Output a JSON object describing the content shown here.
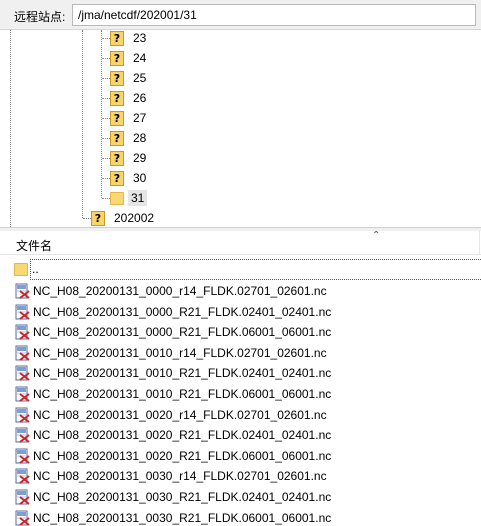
{
  "path_bar": {
    "label": "远程站点:",
    "value": "/jma/netcdf/202001/31"
  },
  "tree": {
    "day_items": [
      "23",
      "24",
      "25",
      "26",
      "27",
      "28",
      "29",
      "30"
    ],
    "selected_item": "31",
    "next_month": "202002"
  },
  "file_list": {
    "column_header": "文件名",
    "parent_entry": "..",
    "files": [
      "NC_H08_20200131_0000_r14_FLDK.02701_02601.nc",
      "NC_H08_20200131_0000_R21_FLDK.02401_02401.nc",
      "NC_H08_20200131_0000_R21_FLDK.06001_06001.nc",
      "NC_H08_20200131_0010_r14_FLDK.02701_02601.nc",
      "NC_H08_20200131_0010_R21_FLDK.02401_02401.nc",
      "NC_H08_20200131_0010_R21_FLDK.06001_06001.nc",
      "NC_H08_20200131_0020_r14_FLDK.02701_02601.nc",
      "NC_H08_20200131_0020_R21_FLDK.02401_02401.nc",
      "NC_H08_20200131_0020_R21_FLDK.06001_06001.nc",
      "NC_H08_20200131_0030_r14_FLDK.02701_02601.nc",
      "NC_H08_20200131_0030_R21_FLDK.02401_02401.nc",
      "NC_H08_20200131_0030_R21_FLDK.06001_06001.nc"
    ]
  },
  "icons": {
    "unknown_folder": "question-folder-icon",
    "folder": "folder-icon",
    "file": "netcdf-file-icon"
  },
  "colors": {
    "unknown_folder_fill": "#f9d46b",
    "folder_fill": "#f8d775",
    "selected_bg": "#e5e5e5",
    "panel_bg": "#f0f0f0"
  }
}
